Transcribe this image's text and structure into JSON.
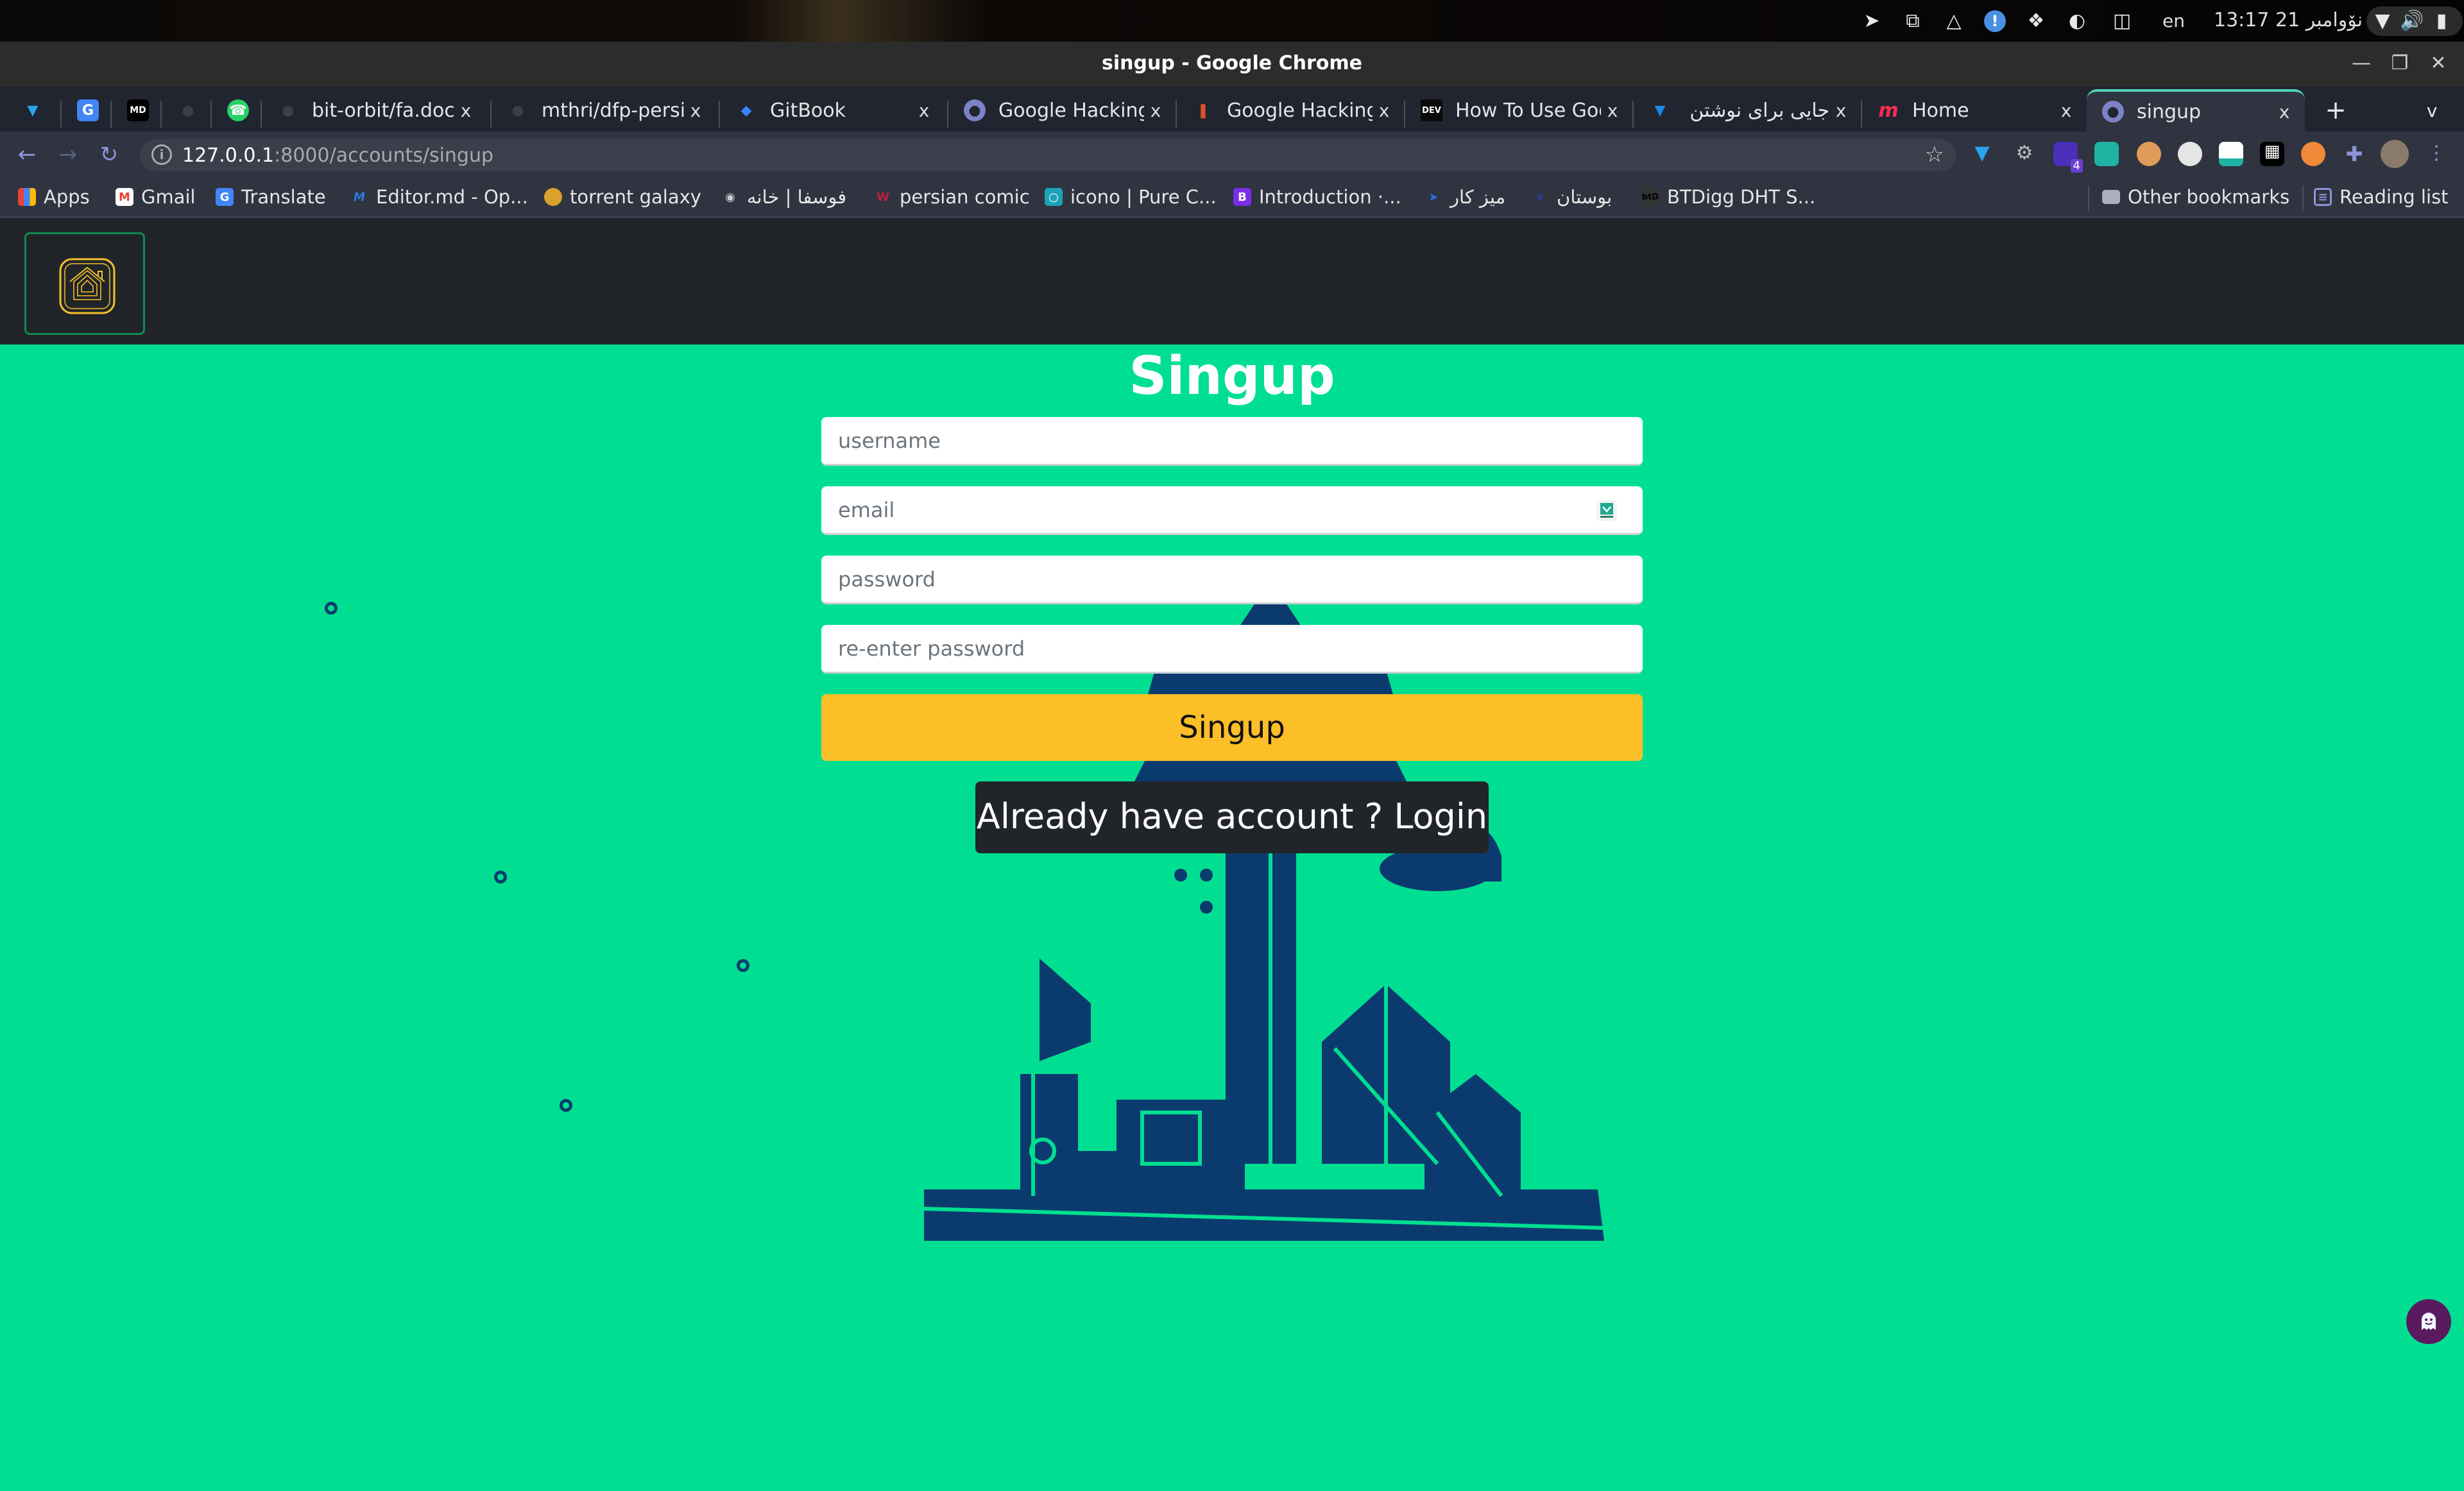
{
  "system_bar": {
    "tray_icons": [
      "telegram-icon",
      "screen-share-icon",
      "vlc-icon",
      "alert-icon",
      "dropbox-icon",
      "contrast-icon",
      "clipboard-icon"
    ],
    "language": "en",
    "clock": "13:17 21 نۆوامبر",
    "status_icons": [
      "wifi-icon",
      "volume-icon",
      "battery-icon"
    ]
  },
  "window": {
    "title": "singup - Google Chrome",
    "controls": [
      "minimize",
      "restore",
      "close"
    ]
  },
  "tabs": [
    {
      "label": "",
      "icon": "maps-pin-icon",
      "pinned": true
    },
    {
      "label": "",
      "icon": "google-translate-icon",
      "pinned": true
    },
    {
      "label": "",
      "icon": "markdown-icon",
      "pinned": true
    },
    {
      "label": "",
      "icon": "github-icon",
      "pinned": true
    },
    {
      "label": "",
      "icon": "whatsapp-icon",
      "pinned": true
    },
    {
      "label": "bit-orbit/fa.doc.r",
      "icon": "github-icon"
    },
    {
      "label": "mthri/dfp-persia",
      "icon": "github-icon"
    },
    {
      "label": "GitBook",
      "icon": "gitbook-icon"
    },
    {
      "label": "Google Hacking",
      "icon": "globe-icon"
    },
    {
      "label": "Google Hacking:",
      "icon": "hacking-site-icon"
    },
    {
      "label": "How To Use Goo",
      "icon": "dev-icon"
    },
    {
      "label": "جایی برای نوشتن",
      "icon": "virgool-icon"
    },
    {
      "label": "Home",
      "icon": "m-logo-icon"
    },
    {
      "label": "singup",
      "icon": "globe-icon",
      "active": true
    }
  ],
  "tab_strip": {
    "new_tab": "+",
    "tab_search": "v",
    "close_glyph": "x"
  },
  "address_bar": {
    "url_host": "127.0.0.1",
    "url_path": ":8000/accounts/singup",
    "extensions": [
      "maps-pin-icon",
      "gears-icon",
      "stacks-icon",
      "save-icon",
      "nerd-icon",
      "ghostery-icon",
      "tempmail-icon",
      "trash-icon",
      "cookie-icon",
      "puzzle-icon",
      "profile-avatar"
    ],
    "extension_badge": "4"
  },
  "bookmarks": {
    "items": [
      {
        "label": "Apps",
        "icon": "apps-grid-icon"
      },
      {
        "label": "Gmail",
        "icon": "gmail-icon"
      },
      {
        "label": "Translate",
        "icon": "google-translate-icon"
      },
      {
        "label": "Editor.md - Op...",
        "icon": "editor-md-icon"
      },
      {
        "label": "torrent galaxy",
        "icon": "torrent-galaxy-icon"
      },
      {
        "label": "فوسفا | خانه",
        "icon": "fossfa-icon"
      },
      {
        "label": "persian comic",
        "icon": "comic-icon"
      },
      {
        "label": "icono | Pure C...",
        "icon": "icono-icon"
      },
      {
        "label": "Introduction ·...",
        "icon": "bootstrap-icon"
      },
      {
        "label": "میز کار",
        "icon": "desk-icon"
      },
      {
        "label": "بوستان",
        "icon": "boostan-icon"
      },
      {
        "label": "BTDigg DHT S...",
        "icon": "btdigg-icon"
      }
    ],
    "other_bookmarks": "Other bookmarks",
    "reading_list": "Reading list"
  },
  "app": {
    "logo": "home-logo-icon",
    "colors": {
      "navbar": "#212529",
      "page_bg": "#00df91",
      "accent": "#fdbf28",
      "logo_border": "#128a52",
      "logo_color": "#f5c02a",
      "illustration": "#0b3b6e"
    }
  },
  "form": {
    "title": "Singup",
    "username_placeholder": "username",
    "email_placeholder": "email",
    "password_placeholder": "password",
    "reenter_placeholder": "re-enter password",
    "submit_label": "Singup",
    "login_prompt": "Already have account ? Login"
  }
}
